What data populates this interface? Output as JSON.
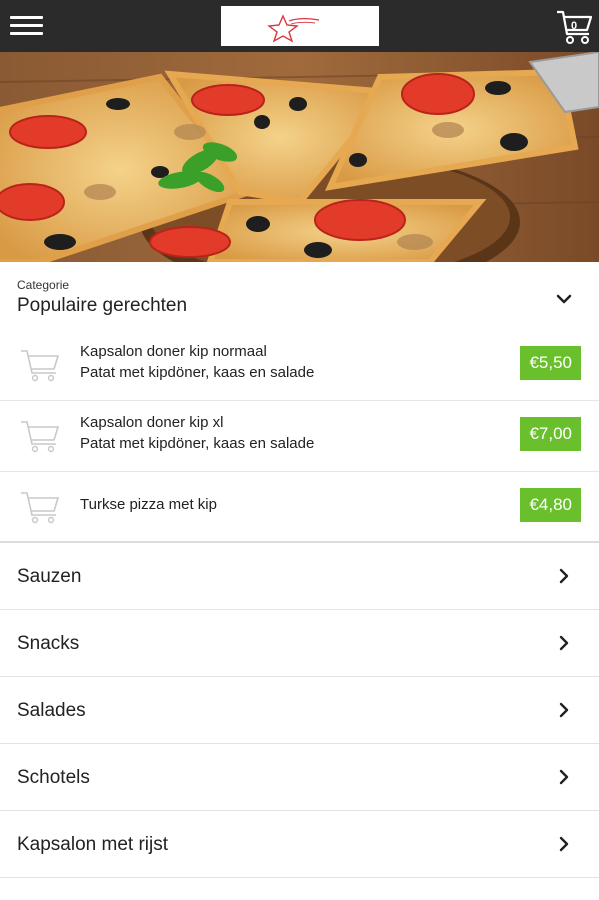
{
  "header": {
    "menu_icon": "hamburger-icon",
    "logo_alt": "restaurant-logo",
    "cart_icon": "shopping-cart-icon",
    "cart_count": "0"
  },
  "hero": {
    "image": "pizza-photo"
  },
  "category": {
    "label": "Categorie",
    "title": "Populaire gerechten",
    "toggle_icon": "chevron-down-icon",
    "items": [
      {
        "name": "Kapsalon doner kip normaal",
        "description": "Patat met kipdöner, kaas en salade",
        "price": "€5,50"
      },
      {
        "name": "Kapsalon doner kip xl",
        "description": "Patat met kipdöner, kaas en salade",
        "price": "€7,00"
      },
      {
        "name": "Turkse pizza met kip",
        "description": "",
        "price": "€4,80"
      }
    ]
  },
  "categories": [
    {
      "label": "Sauzen"
    },
    {
      "label": "Snacks"
    },
    {
      "label": "Salades"
    },
    {
      "label": "Schotels"
    },
    {
      "label": "Kapsalon met rijst"
    }
  ],
  "colors": {
    "topbar": "#2b2b2b",
    "price_badge": "#6abf2c",
    "logo_accent": "#d9363e"
  }
}
